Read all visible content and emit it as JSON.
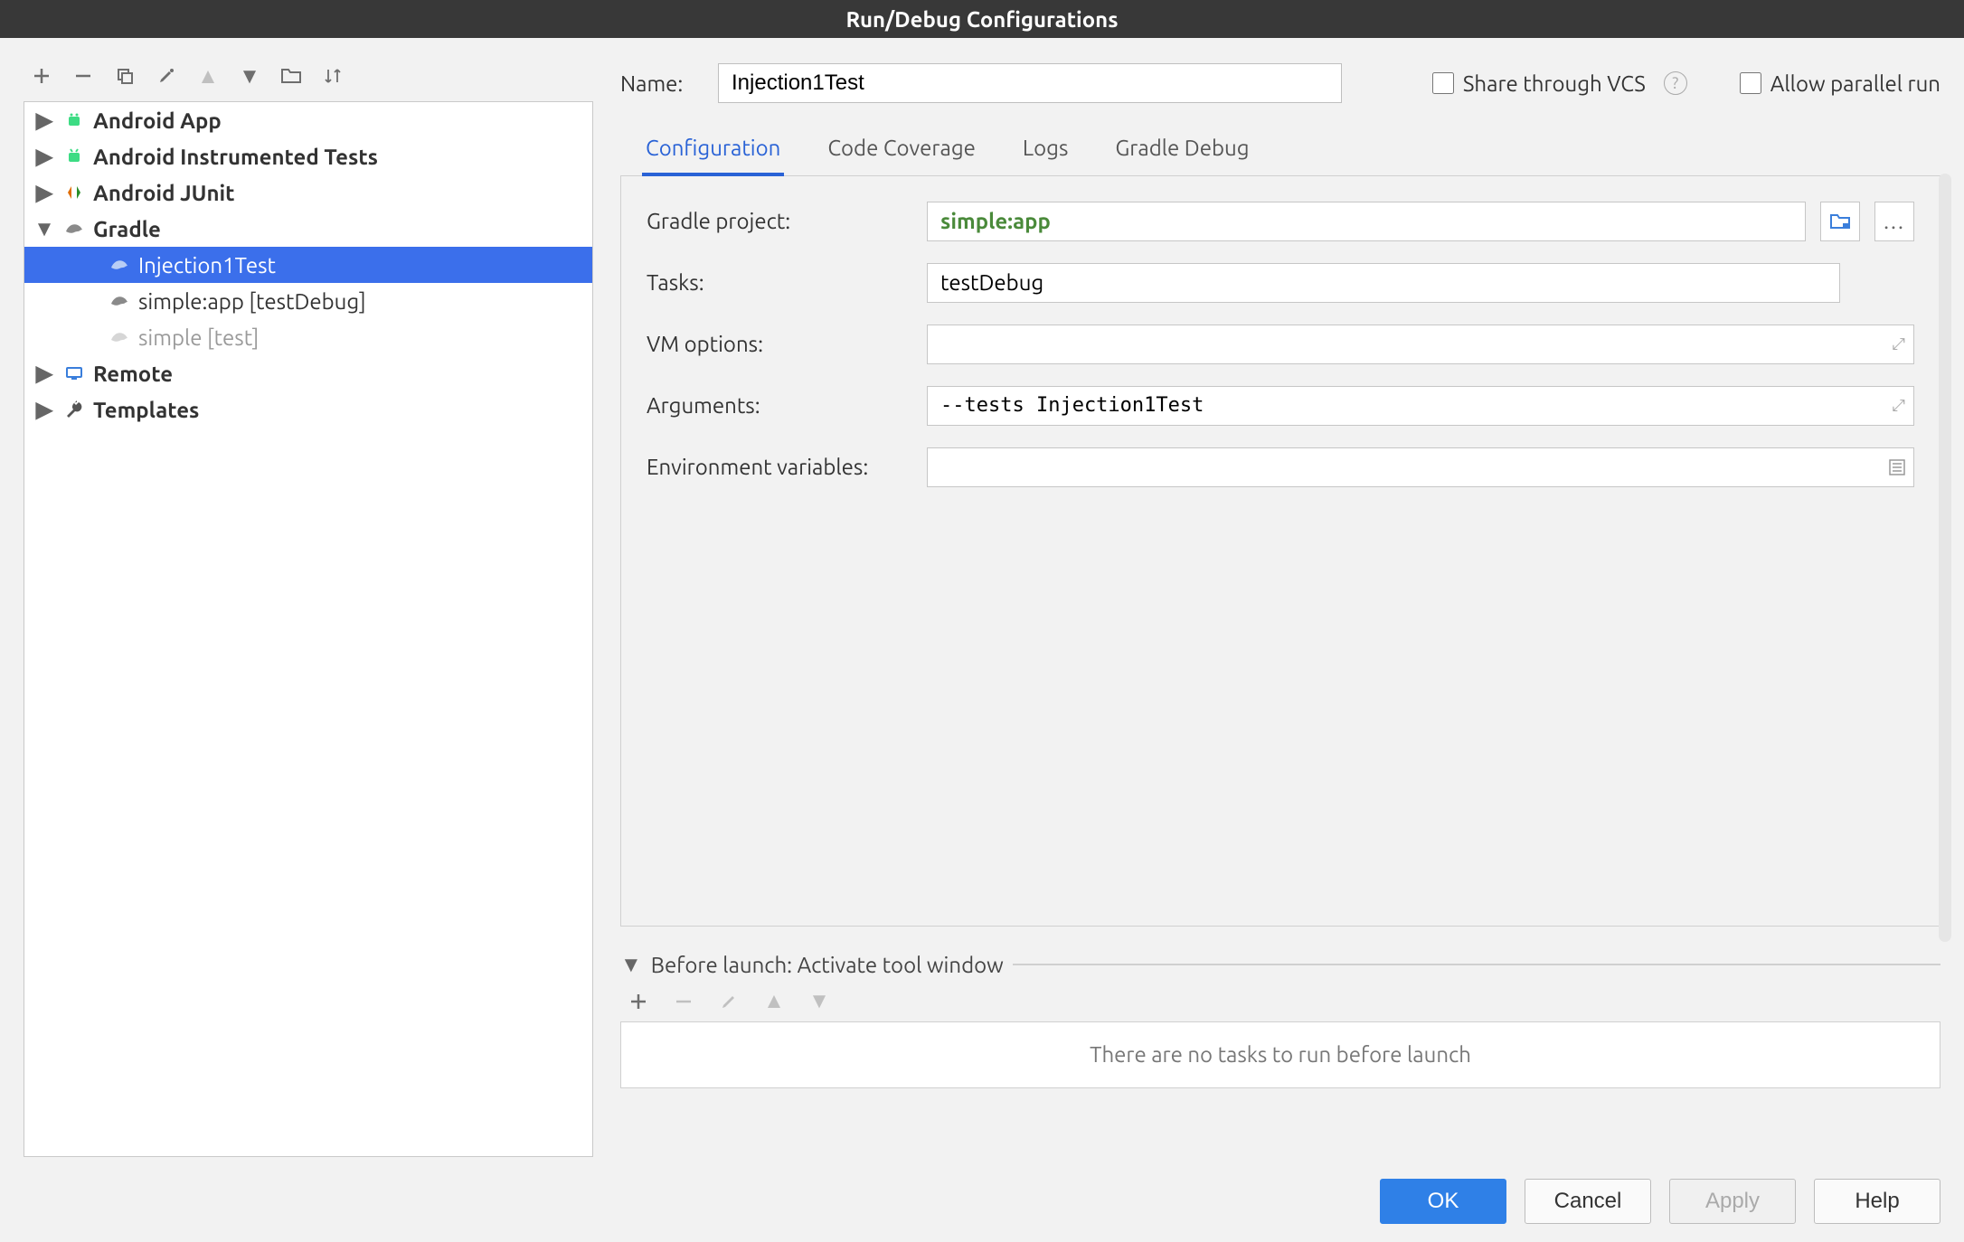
{
  "title": "Run/Debug Configurations",
  "toolbar": {
    "add": "+",
    "remove": "−",
    "copy": "⿻",
    "edit": "🔧",
    "up": "▲",
    "down": "▼",
    "folder": "📁",
    "sort": "⇅"
  },
  "tree": {
    "android_app": "Android App",
    "android_instrumented": "Android Instrumented Tests",
    "android_junit": "Android JUnit",
    "gradle": "Gradle",
    "gradle_children": [
      "Injection1Test",
      "simple:app [testDebug]",
      "simple [test]"
    ],
    "remote": "Remote",
    "templates": "Templates"
  },
  "name_label": "Name:",
  "name_value": "Injection1Test",
  "share_vcs": "Share through VCS",
  "allow_parallel": "Allow parallel run",
  "tabs": [
    "Configuration",
    "Code Coverage",
    "Logs",
    "Gradle Debug"
  ],
  "form": {
    "gradle_project_label": "Gradle project:",
    "gradle_project_value": "simple:app",
    "tasks_label": "Tasks:",
    "tasks_value": "testDebug",
    "vm_options_label": "VM options:",
    "vm_options_value": "",
    "arguments_label": "Arguments:",
    "arguments_value": "--tests Injection1Test",
    "env_label": "Environment variables:",
    "env_value": ""
  },
  "before_launch": {
    "header": "Before launch: Activate tool window",
    "empty": "There are no tasks to run before launch"
  },
  "buttons": {
    "ok": "OK",
    "cancel": "Cancel",
    "apply": "Apply",
    "help": "Help"
  }
}
